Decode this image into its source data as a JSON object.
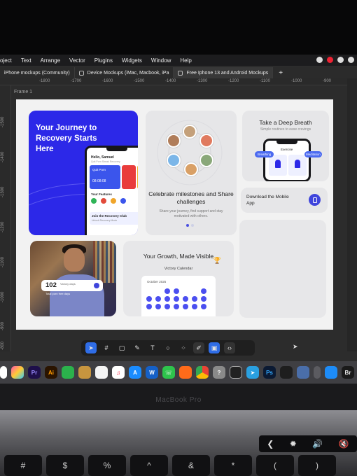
{
  "menubar": {
    "items": [
      "oject",
      "Text",
      "Arrange",
      "Vector",
      "Plugins",
      "Widgets",
      "Window",
      "Help"
    ]
  },
  "tabs": [
    {
      "label": "iPhone mockups (Community)"
    },
    {
      "label": "Device Mockups (iMac, Macbook, iPa"
    },
    {
      "label": "Free Iphone 13 and Android Mockups"
    }
  ],
  "tab_add": "+",
  "ruler": {
    "h": [
      "-1800",
      "-1700",
      "-1600",
      "-1500",
      "-1400",
      "-1300",
      "-1200",
      "-1100",
      "-1000",
      "-900"
    ],
    "v": [
      "-1500",
      "-1400",
      "-1300",
      "-1200",
      "-1100",
      "-1000",
      "-900",
      "-800"
    ]
  },
  "frame_label": "Frame 1",
  "cards": {
    "journey": {
      "title": "Your Journey to Recovery Starts Here",
      "greeting": "Hello, Samuel",
      "greeting_sub": "Quit Porn Streak Recovery",
      "quit_label": "Quit Porn",
      "timer": "08:08:08",
      "features": "Your Features",
      "club": "Join the Recovery Club",
      "club_sub": "Unlock Recovery Mode"
    },
    "milestones": {
      "title": "Celebrate milestones and Share challenges",
      "subtitle": "Share your journey, find support and stay motivated with others."
    },
    "breath": {
      "title": "Take a Deep Breath",
      "subtitle": "Simple routines to ease cravings",
      "chip_left": "Breathing",
      "chip_right": "Meditation",
      "screen_title": "Exercise"
    },
    "download": {
      "title": "Download the Mobile App"
    },
    "photo": {
      "count": "102",
      "count_label": "Victory days",
      "count_sub": "Total porn free days"
    },
    "growth": {
      "title": "Your Growth, Made Visible",
      "calendar_title": "Victory Calendar",
      "month": "October 2025"
    }
  },
  "dock_apps": [
    "Pr",
    "Ai",
    "Ps",
    "Br"
  ],
  "laptop_label": "MacBook Pro",
  "keys": [
    "#",
    "$",
    "%",
    "^",
    "&",
    "*",
    "(",
    ")"
  ],
  "colors": {
    "brand_blue": "#2c28e8",
    "accent": "#3f45dc",
    "canvas": "#f2f2f2",
    "figma_bg": "#2c2c2c"
  }
}
